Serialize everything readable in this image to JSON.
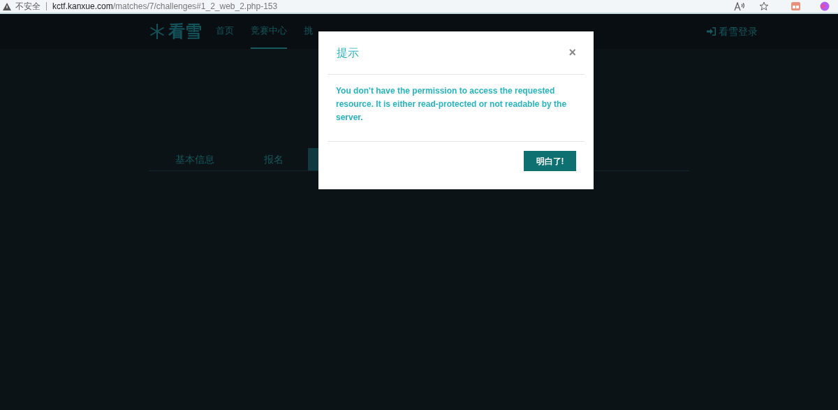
{
  "browser": {
    "security": "不安全",
    "url_host": "kctf.kanxue.com",
    "url_path": "/matches/7/challenges#1_2_web_2.php-153"
  },
  "nav": {
    "logo": "看雪",
    "items": [
      {
        "label": "首页",
        "selected": false
      },
      {
        "label": "竞赛中心",
        "selected": true
      },
      {
        "label": "挑",
        "selected": false
      }
    ],
    "login": "看雪登录"
  },
  "tabs": [
    {
      "label": "基本信息",
      "selected": false
    },
    {
      "label": "报名",
      "selected": false
    },
    {
      "selected": true
    }
  ],
  "modal": {
    "title": "提示",
    "close": "×",
    "message": "You don't have the permission to access the requested resource. It is either read-protected or not readable by the server.",
    "button": "明白了!"
  }
}
